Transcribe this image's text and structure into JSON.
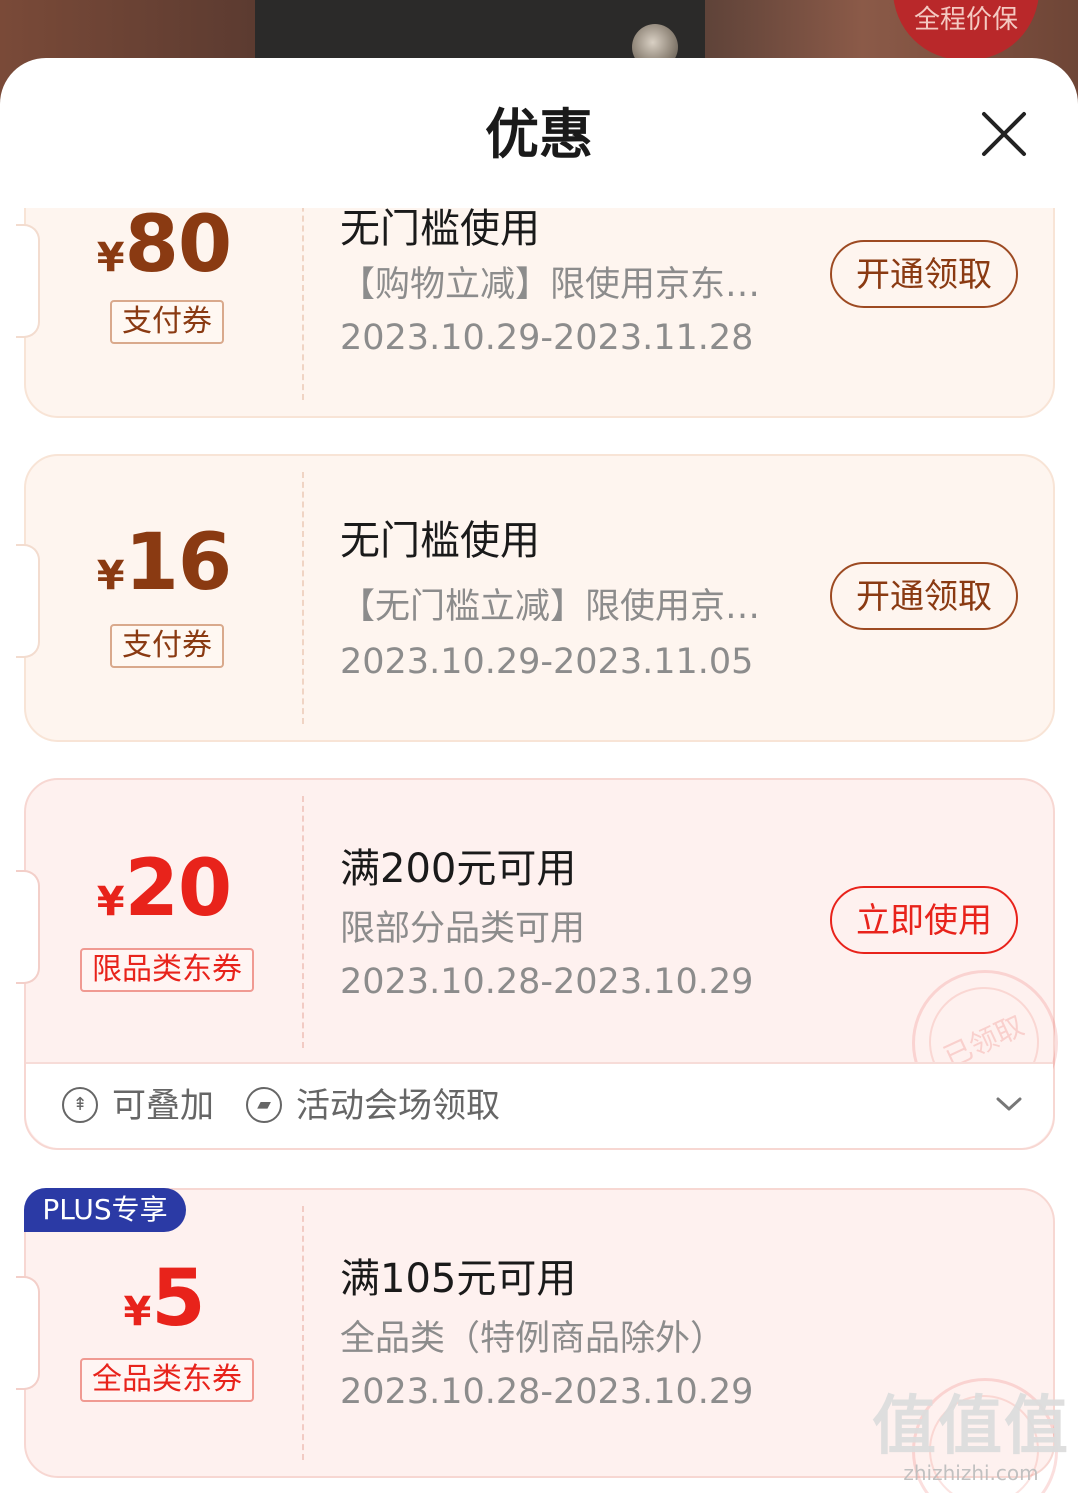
{
  "background": {
    "badge_text": "全程价保"
  },
  "sheet": {
    "title": "优惠",
    "close_icon": "close-icon"
  },
  "coupons": [
    {
      "currency": "¥",
      "amount": "80",
      "tag": "支付券",
      "title": "无门槛使用",
      "description": "【购物立减】限使用京东…",
      "dates": "2023.10.29-2023.11.28",
      "button": "开通领取"
    },
    {
      "currency": "¥",
      "amount": "16",
      "tag": "支付券",
      "title": "无门槛使用",
      "description": "【无门槛立减】限使用京…",
      "dates": "2023.10.29-2023.11.05",
      "button": "开通领取"
    },
    {
      "currency": "¥",
      "amount": "20",
      "tag": "限品类东券",
      "title": "满200元可用",
      "description": "限部分品类可用",
      "dates": "2023.10.28-2023.10.29",
      "button": "立即使用",
      "stamp": "已领取",
      "footer": {
        "stackable": "可叠加",
        "source": "活动会场领取"
      }
    },
    {
      "badge": "PLUS专享",
      "currency": "¥",
      "amount": "5",
      "tag": "全品类东券",
      "title": "满105元可用",
      "description": "全品类（特例商品除外）",
      "dates": "2023.10.28-2023.10.29"
    }
  ],
  "watermark": {
    "logo": "值值值",
    "site": "zhizhizhi.com"
  },
  "colors": {
    "gold_text": "#8a3a12",
    "red_text": "#e8231b",
    "plus_badge": "#2b3aa5"
  }
}
